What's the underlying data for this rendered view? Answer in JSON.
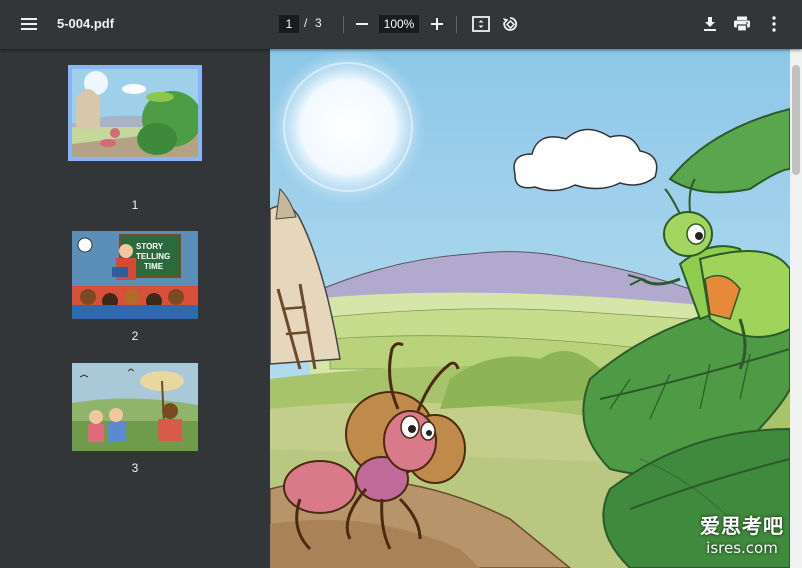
{
  "toolbar": {
    "file_name": "5-004.pdf",
    "current_page": "1",
    "page_separator": "/",
    "total_pages": "3",
    "zoom_value": "100%"
  },
  "sidebar": {
    "thumbnails": [
      {
        "label": "1",
        "selected": true
      },
      {
        "label": "2",
        "selected": false
      },
      {
        "label": "3",
        "selected": false
      }
    ]
  },
  "thumbnail_2": {
    "board_text_1": "STORY",
    "board_text_2": "TELLING",
    "board_text_3": "TIME"
  },
  "watermark": {
    "line1": "爱思考吧",
    "line2": "isres.com"
  },
  "colors": {
    "toolbar_bg": "#323639",
    "viewer_bg": "#525659",
    "selected_outline": "#8ab4f8"
  }
}
